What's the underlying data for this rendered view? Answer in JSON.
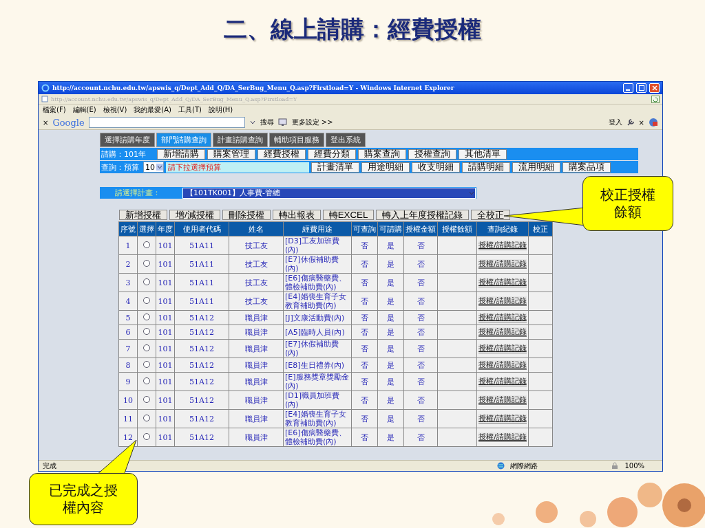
{
  "slide_title": "二、線上請購：經費授權",
  "window": {
    "title": "http://account.nchu.edu.tw/apswis_q/Dept_Add_Q/DA_SerBug_Menu_Q.asp?Firstload=Y - Windows Internet Explorer",
    "address": "http://account.nchu.edu.tw/apswis_q/Dept_Add_Q/DA_SerBug_Menu_Q.asp?Firstload=Y"
  },
  "menu": [
    "檔案(F)",
    "編輯(E)",
    "檢視(V)",
    "我的最愛(A)",
    "工具(T)",
    "說明(H)"
  ],
  "google_toolbar": {
    "close": "×",
    "close_right": "×",
    "logo": "Google",
    "search_button": "搜尋",
    "more": "更多設定 >>",
    "sign_in": "登入"
  },
  "main_tabs": [
    {
      "label": "選擇請購年度",
      "selected": false
    },
    {
      "label": "部門請購查詢",
      "selected": true
    },
    {
      "label": "計畫請購查詢",
      "selected": false
    },
    {
      "label": "輔助項目服務",
      "selected": false
    },
    {
      "label": "登出系統",
      "selected": false
    }
  ],
  "request_row": {
    "label": "請購：101年",
    "buttons": [
      "新增請購",
      "購案管理",
      "經費授權",
      "經費分類",
      "購案查詢",
      "授權查詢",
      "其他清單"
    ]
  },
  "query_row": {
    "label": "查詢：預算",
    "select": "10",
    "hint": "請下拉選擇預算",
    "buttons": [
      "計畫清單",
      "用途明細",
      "收支明細",
      "請購明細",
      "流用明細",
      "購案品項"
    ]
  },
  "plan": {
    "label": "請選擇計畫：",
    "value": "【101TK001】人事費-管總"
  },
  "actions": [
    "新增授權",
    "增/減授權",
    "刪除授權",
    "轉出報表",
    "轉EXCEL",
    "轉入上年度授權記錄",
    "全校正"
  ],
  "table": {
    "columns": [
      "序號",
      "選擇",
      "年度",
      "使用者代碼",
      "姓名",
      "經費用途",
      "可查詢",
      "可請購",
      "授權金額",
      "授權餘額",
      "查詢紀錄",
      "校正"
    ],
    "rows": [
      {
        "no": "1",
        "selected": false,
        "year": "101",
        "code": "51A11",
        "name": "技工友",
        "purpose": "[D3]工友加班費(內)",
        "query": "否",
        "request": "是",
        "amount": "否",
        "record": "授權/請購記錄"
      },
      {
        "no": "2",
        "selected": false,
        "year": "101",
        "code": "51A11",
        "name": "技工友",
        "purpose": "[E7]休假補助費(內)",
        "query": "否",
        "request": "是",
        "amount": "否",
        "record": "授權/請購記錄"
      },
      {
        "no": "3",
        "selected": false,
        "year": "101",
        "code": "51A11",
        "name": "技工友",
        "purpose": "[E6]傷病醫藥費、體檢補助費(內)",
        "query": "否",
        "request": "是",
        "amount": "否",
        "record": "授權/請購記錄"
      },
      {
        "no": "4",
        "selected": false,
        "year": "101",
        "code": "51A11",
        "name": "技工友",
        "purpose": "[E4]婚喪生育子女教育補助費(內)",
        "query": "否",
        "request": "是",
        "amount": "否",
        "record": "授權/請購記錄"
      },
      {
        "no": "5",
        "selected": false,
        "year": "101",
        "code": "51A12",
        "name": "職員津",
        "purpose": "[J]文康活動費(內)",
        "query": "否",
        "request": "是",
        "amount": "否",
        "record": "授權/請購記錄"
      },
      {
        "no": "6",
        "selected": false,
        "year": "101",
        "code": "51A12",
        "name": "職員津",
        "purpose": "[A5]臨時人員(內)",
        "query": "否",
        "request": "是",
        "amount": "否",
        "record": "授權/請購記錄"
      },
      {
        "no": "7",
        "selected": false,
        "year": "101",
        "code": "51A12",
        "name": "職員津",
        "purpose": "[E7]休假補助費(內)",
        "query": "否",
        "request": "是",
        "amount": "否",
        "record": "授權/請購記錄"
      },
      {
        "no": "8",
        "selected": false,
        "year": "101",
        "code": "51A12",
        "name": "職員津",
        "purpose": "[E8]生日禮券(內)",
        "query": "否",
        "request": "是",
        "amount": "否",
        "record": "授權/請購記錄"
      },
      {
        "no": "9",
        "selected": false,
        "year": "101",
        "code": "51A12",
        "name": "職員津",
        "purpose": "[E]服務獎章獎勵金(內)",
        "query": "否",
        "request": "是",
        "amount": "否",
        "record": "授權/請購記錄"
      },
      {
        "no": "10",
        "selected": false,
        "year": "101",
        "code": "51A12",
        "name": "職員津",
        "purpose": "[D1]職員加班費(內)",
        "query": "否",
        "request": "是",
        "amount": "否",
        "record": "授權/請購記錄"
      },
      {
        "no": "11",
        "selected": false,
        "year": "101",
        "code": "51A12",
        "name": "職員津",
        "purpose": "[E4]婚喪生育子女教育補助費(內)",
        "query": "否",
        "request": "是",
        "amount": "否",
        "record": "授權/請購記錄"
      },
      {
        "no": "12",
        "selected": false,
        "year": "101",
        "code": "51A12",
        "name": "職員津",
        "purpose": "[E6]傷病醫藥費、體檢補助費(內)",
        "query": "否",
        "request": "是",
        "amount": "否",
        "record": "授權/請購記錄"
      }
    ]
  },
  "status_bar": {
    "status": "完成",
    "zone": "網際網路",
    "zoom": "100%"
  },
  "callouts": [
    {
      "text": "校正授權餘額",
      "kind": "right"
    },
    {
      "text": "已完成之授權內容",
      "kind": "bottom"
    }
  ]
}
